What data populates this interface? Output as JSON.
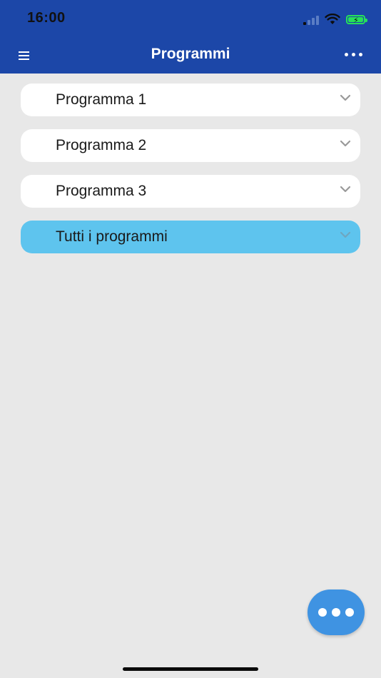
{
  "status_bar": {
    "time": "16:00",
    "icons": [
      "cellular-signal-icon",
      "wifi-icon",
      "battery-charging-icon"
    ]
  },
  "header": {
    "title": "Programmi",
    "menu_icon": "hamburger-menu-icon",
    "more_icon": "more-horizontal-icon"
  },
  "programs": {
    "items": [
      {
        "label": "Programma 1",
        "icon": "chevron-down-icon"
      },
      {
        "label": "Programma 2",
        "icon": "chevron-down-icon"
      },
      {
        "label": "Programma 3",
        "icon": "chevron-down-icon"
      },
      {
        "label": "Tutti i programmi",
        "icon": "chevron-down-icon",
        "selected": true
      }
    ]
  },
  "fab": {
    "icon": "more-horizontal-icon"
  },
  "colors": {
    "header_bg": "#1c47a8",
    "page_bg": "#e8e8e8",
    "item_bg": "#ffffff",
    "selected_item_bg": "#5ec4ee",
    "fab_bg": "#3f93e2",
    "battery": "#26e05a"
  }
}
